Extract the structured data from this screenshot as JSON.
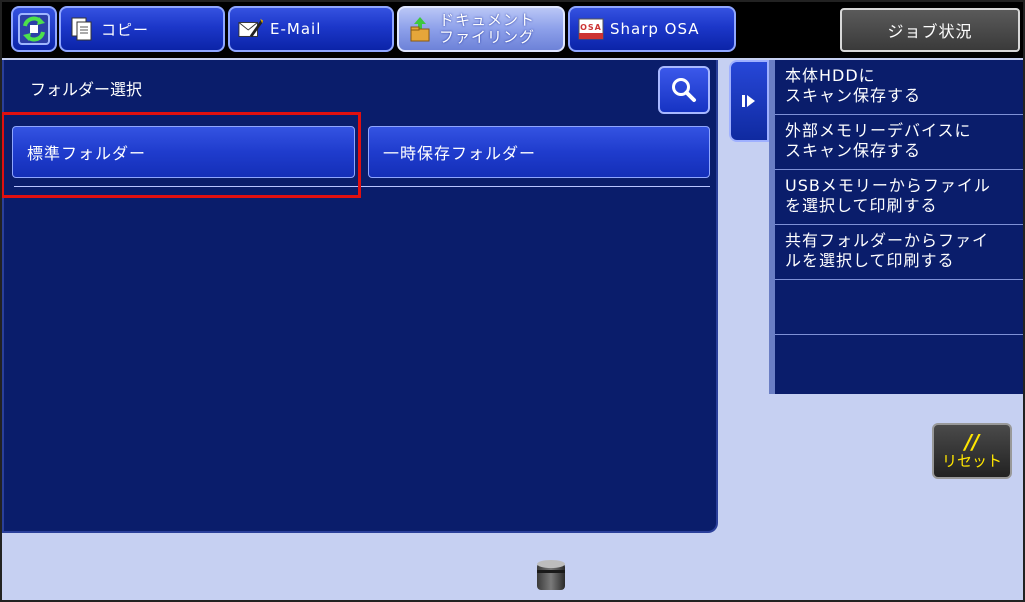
{
  "tabs": [
    {
      "id": "copy",
      "label": "コピー",
      "icon": "copy-icon"
    },
    {
      "id": "email",
      "label": "E-Mail",
      "icon": "email-icon"
    },
    {
      "id": "document-filing",
      "label_line1": "ドキュメント",
      "label_line2": "ファイリング",
      "icon": "document-filing-icon",
      "active": true
    },
    {
      "id": "sharp-osa",
      "label": "Sharp OSA",
      "icon": "osa-icon",
      "icon_text": "OSA"
    }
  ],
  "job_status": {
    "label": "ジョブ状況"
  },
  "panel": {
    "title": "フォルダー選択",
    "folders": [
      {
        "label": "標準フォルダー",
        "highlighted": true
      },
      {
        "label": "一時保存フォルダー",
        "highlighted": false
      }
    ]
  },
  "side_menu": {
    "items": [
      {
        "label": "本体HDDに\nスキャン保存する"
      },
      {
        "label": "外部メモリーデバイスに\nスキャン保存する"
      },
      {
        "label": "USBメモリーからファイル\nを選択して印刷する"
      },
      {
        "label": "共有フォルダーからファイ\nルを選択して印刷する"
      },
      {
        "label": ""
      },
      {
        "label": ""
      }
    ]
  },
  "reset": {
    "slashes": "//",
    "label": "リセット"
  },
  "colors": {
    "background": "#c6d0f2",
    "panel": "#0a1d6b",
    "button": "#1f3ccd",
    "highlight": "#e01010",
    "reset_text": "#ffe600"
  }
}
